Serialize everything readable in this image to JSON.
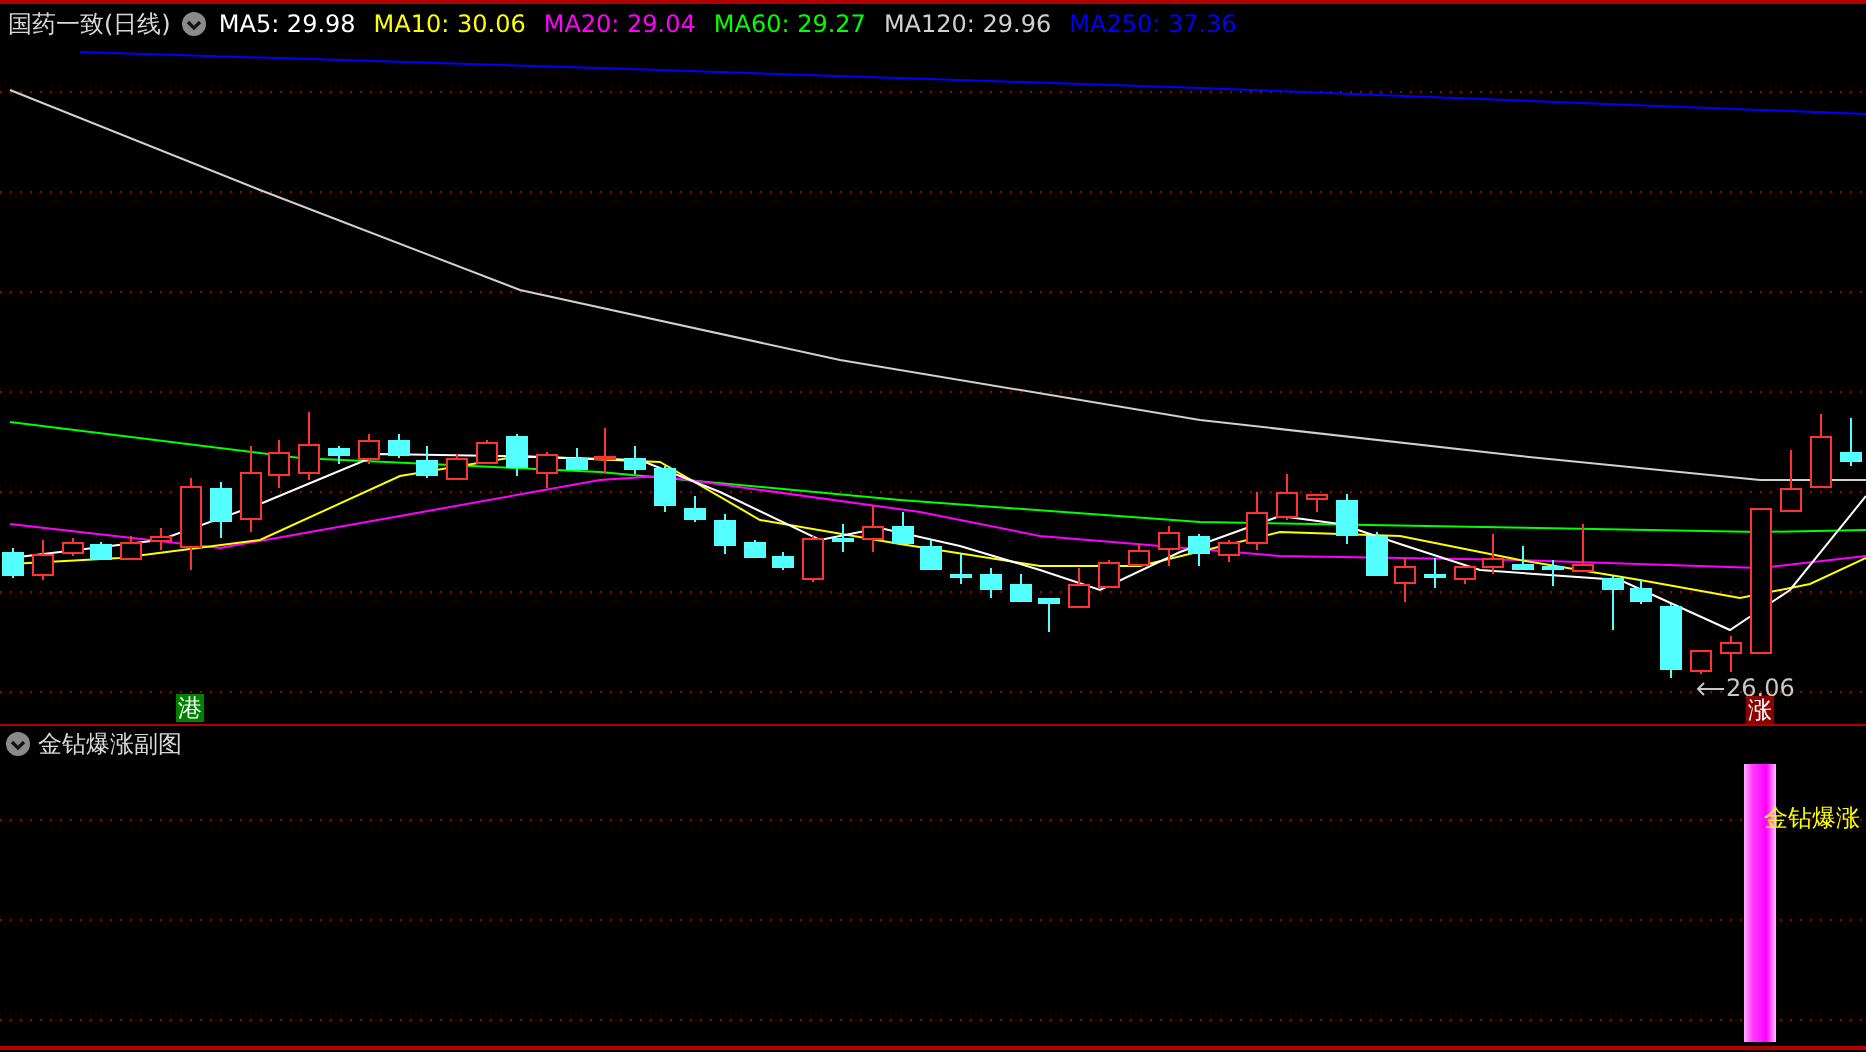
{
  "header": {
    "title": "国药一致(日线)",
    "indicators": [
      {
        "label": "MA5: 29.98",
        "color": "#ffffff"
      },
      {
        "label": "MA10: 30.06",
        "color": "#ffff00"
      },
      {
        "label": "MA20: 29.04",
        "color": "#ff00ff"
      },
      {
        "label": "MA60: 29.27",
        "color": "#00ff00"
      },
      {
        "label": "MA120: 29.96",
        "color": "#d0d0d0"
      },
      {
        "label": "MA250: 37.36",
        "color": "#0000ff"
      }
    ]
  },
  "main_chart": {
    "low_price_label": "26.06",
    "badges": [
      {
        "text": "港",
        "color": "#008000"
      },
      {
        "text": "涨",
        "color": "#8b0000"
      }
    ]
  },
  "sub_chart": {
    "title": "金钻爆涨副图",
    "signal_label": "金钻爆涨"
  }
}
